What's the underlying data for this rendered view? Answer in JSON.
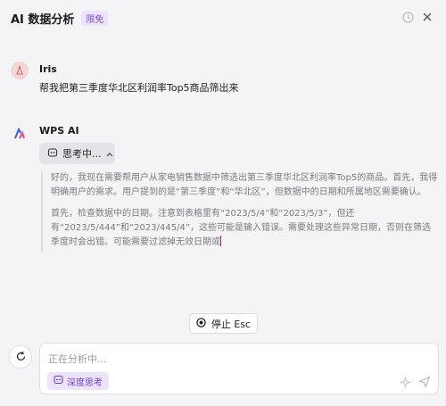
{
  "header": {
    "title": "AI 数据分析",
    "badge": "限免",
    "history_icon": "clock-icon",
    "close_icon": "close-icon"
  },
  "user_message": {
    "name": "Iris",
    "text": "帮我把第三季度华北区利润率Top5商品筛出来"
  },
  "ai_message": {
    "name": "WPS AI",
    "thinking_label": "思考中...",
    "paragraphs": [
      "好的，我现在需要帮用户从家电销售数据中筛选出第三季度华北区利润率Top5的商品。首先，我得明确用户的需求。用户提到的是“第三季度”和“华北区”，但数据中的日期和所属地区需要确认。",
      "首先，检查数据中的日期。注意到表格里有“2023/5/4”和“2023/5/3”，但还有“2023/5/444”和“2023/445/4”，这些可能是输入错误。需要处理这些异常日期，否则在筛选季度时会出错。可能需要过滤掉无效日期或"
    ]
  },
  "stop_button": {
    "label": "停止 Esc"
  },
  "input": {
    "placeholder": "正在分析中...",
    "deep_think_label": "深度思考"
  },
  "colors": {
    "accent": "#7b4ad8",
    "badge_bg": "#ece3ff",
    "background": "#f4f4f6"
  }
}
